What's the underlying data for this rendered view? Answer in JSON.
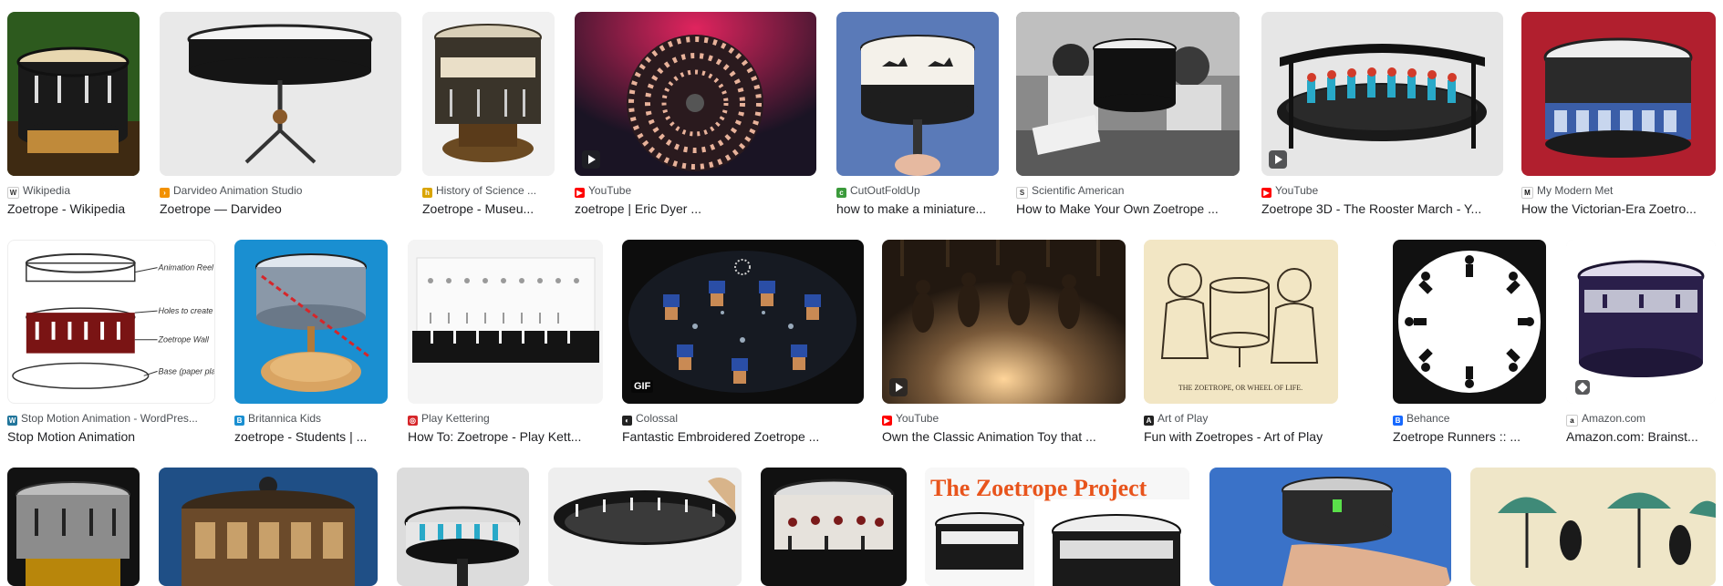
{
  "results": [
    {
      "source": "Wikipedia",
      "title": "Zoetrope - Wikipedia"
    },
    {
      "source": "Darvideo Animation Studio",
      "title": "Zoetrope — Darvideo"
    },
    {
      "source": "History of Science ...",
      "title": "Zoetrope - Museu..."
    },
    {
      "source": "YouTube",
      "title": "zoetrope | Eric Dyer ..."
    },
    {
      "source": "CutOutFoldUp",
      "title": "how to make a miniature..."
    },
    {
      "source": "Scientific American",
      "title": "How to Make Your Own Zoetrope ..."
    },
    {
      "source": "YouTube",
      "title": "Zoetrope 3D - The Rooster March - Y..."
    },
    {
      "source": "My Modern Met",
      "title": "How the Victorian-Era Zoetro..."
    },
    {
      "source": "Stop Motion Animation - WordPres...",
      "title": "Stop Motion Animation"
    },
    {
      "source": "Britannica Kids",
      "title": "zoetrope - Students | ..."
    },
    {
      "source": "Play Kettering",
      "title": "How To: Zoetrope - Play Kett..."
    },
    {
      "source": "Colossal",
      "title": "Fantastic Embroidered Zoetrope ..."
    },
    {
      "source": "YouTube",
      "title": "Own the Classic Animation Toy that ..."
    },
    {
      "source": "Art of Play",
      "title": "Fun with Zoetropes - Art of Play"
    },
    {
      "source": "Behance",
      "title": "Zoetrope Runners :: ..."
    },
    {
      "source": "Amazon.com",
      "title": "Amazon.com: Brainst..."
    }
  ],
  "overlays": {
    "gif": "GIF"
  },
  "image_text": {
    "sketch_labels": [
      "Animation Reel",
      "Holes to create strobe e",
      "Zoetrope Wall",
      "Base (paper plate)"
    ],
    "engraving_caption": "THE ZOETROPE, OR WHEEL OF LIFE.",
    "project_banner": "The Zoetrope Project"
  },
  "colors": {
    "source_text": "#4d5156",
    "title_text": "#202124",
    "youtube_red": "#ff0000",
    "banner_orange": "#e8541c",
    "britannica_blue": "#1a8fd1"
  }
}
